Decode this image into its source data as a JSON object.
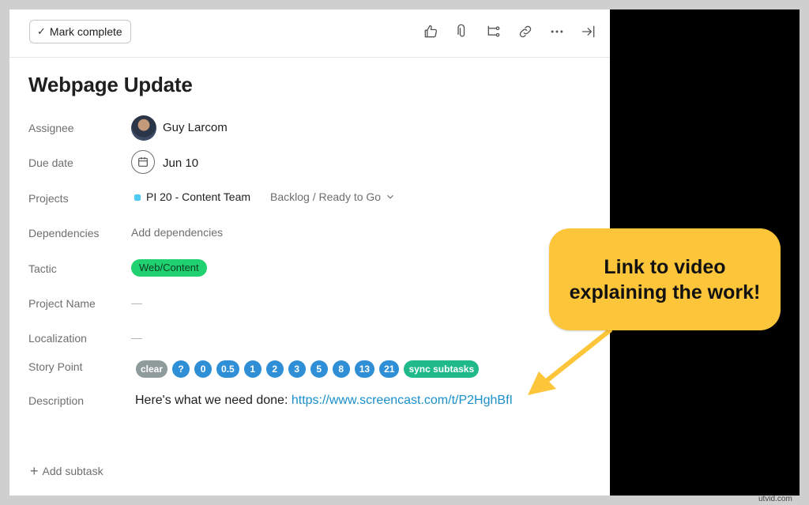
{
  "toolbar": {
    "mark_complete_label": "Mark complete",
    "icons": [
      "thumbs-up-icon",
      "paperclip-icon",
      "subtask-icon",
      "link-icon",
      "more-icon",
      "collapse-panel-icon"
    ]
  },
  "task": {
    "title": "Webpage Update",
    "fields": {
      "assignee_label": "Assignee",
      "assignee_value": "Guy Larcom",
      "due_label": "Due date",
      "due_value": "Jun 10",
      "projects_label": "Projects",
      "project_name": "PI 20 - Content Team",
      "project_section": "Backlog / Ready to Go",
      "dependencies_label": "Dependencies",
      "dependencies_value": "Add dependencies",
      "tactic_label": "Tactic",
      "tactic_value": "Web/Content",
      "project_name_label": "Project Name",
      "project_name_value": "—",
      "localization_label": "Localization",
      "localization_value": "—",
      "story_point_label": "Story Point",
      "description_label": "Description"
    },
    "story_points": [
      "clear",
      "?",
      "0",
      "0.5",
      "1",
      "2",
      "3",
      "5",
      "8",
      "13",
      "21",
      "sync subtasks"
    ],
    "description_text": "Here's what we need done: ",
    "description_link": "https://www.screencast.com/t/P2HghBfI",
    "add_subtask_label": "Add subtask"
  },
  "callout": {
    "line1": "Link to video",
    "line2": "explaining the work!"
  },
  "watermark": "utvid.com",
  "colors": {
    "tactic_pill": "#1fd170",
    "story_point": "#2f8fd6",
    "callout": "#fcc53a",
    "link": "#1a8fc9"
  }
}
